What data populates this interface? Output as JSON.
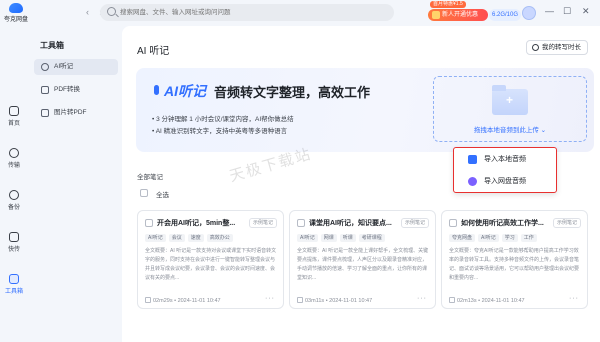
{
  "app": {
    "logo_text": "夸克网盘"
  },
  "nav": {
    "arrows": "‹ ›"
  },
  "search": {
    "placeholder": "搜索网盘、文件、输入网址或询问问题"
  },
  "promo": {
    "tag": "首月特惠¥1.5",
    "label": "新人开通优惠"
  },
  "storage": {
    "label": "6.2G/10G"
  },
  "window": {
    "minimize": "—",
    "maximize": "☐",
    "close": "✕"
  },
  "rail": [
    {
      "label": "首页"
    },
    {
      "label": "传输"
    },
    {
      "label": "备份"
    },
    {
      "label": "快传"
    },
    {
      "label": "工具箱"
    }
  ],
  "sidebar": {
    "title": "工具箱",
    "items": [
      {
        "label": "AI听记"
      },
      {
        "label": "PDF转换"
      },
      {
        "label": "图片转PDF"
      }
    ]
  },
  "main": {
    "title": "AI 听记",
    "my_button": "我的转写时长"
  },
  "banner": {
    "brand": "AI听记",
    "title": "音频转文字整理，高效工作",
    "bullets": [
      "• 3 分钟理解 1 小时会议/课堂内容，AI帮你做总结",
      "• AI 精准识别转文字，支持中英粤等多语种语言"
    ],
    "drop_text": "拖拽本地音频到此上传 ⌄"
  },
  "notes": {
    "section_label": "全部笔记",
    "select_all": "全选"
  },
  "cards": [
    {
      "title": "开会用AI听记，5min整...",
      "badge": "示例笔记",
      "tags": [
        "AI听记",
        "会议",
        "速度",
        "高效办公"
      ],
      "body": "全文概要：AI 听记是一款支持对会议或课堂下实时语音转文字的服务，同时支持在会议中进行一键智能转写整理会议与并且转写成会议纪要，会议录音、会议的会议时间速度、会议有关的要点...",
      "duration": "02m29s",
      "date": "2024-11-01 10:47"
    },
    {
      "title": "课堂用AI听记，知识要点...",
      "badge": "示例笔记",
      "tags": [
        "AI听记",
        "网课",
        "听课",
        "考研课程"
      ],
      "body": "全文概要：AI 听记是一款全能上课好帮手，全文梳理、关键要点提炼，课件要点梳理，人声区分以及跟录音精准对应，手动调节播放的倍速、学习了解全面的重点，让你所有的课堂知识...",
      "duration": "03m11s",
      "date": "2024-11-01 10:47"
    },
    {
      "title": "如何使用听记高效工作学...",
      "badge": "示例笔记",
      "tags": [
        "夸克网盘",
        "AI听记",
        "学习",
        "工作"
      ],
      "body": "全文概要：夸克AI听记是一款能够帮助用户提高工作学习效率的录音转写工具。支持多种音频文件的上传，会议录音笔记、面试访谈等场景适用，它可以帮助用户整理出会议纪要和重要内容...",
      "duration": "02m13s",
      "date": "2024-11-01 10:47"
    }
  ],
  "menu": {
    "items": [
      {
        "label": "导入本地音频",
        "color": "#3370ff"
      },
      {
        "label": "导入网盘音频",
        "color": "#7b61ff"
      }
    ]
  },
  "watermark": "天极下载站",
  "colors": {
    "accent": "#3370ff",
    "highlight": "#e8302f"
  }
}
